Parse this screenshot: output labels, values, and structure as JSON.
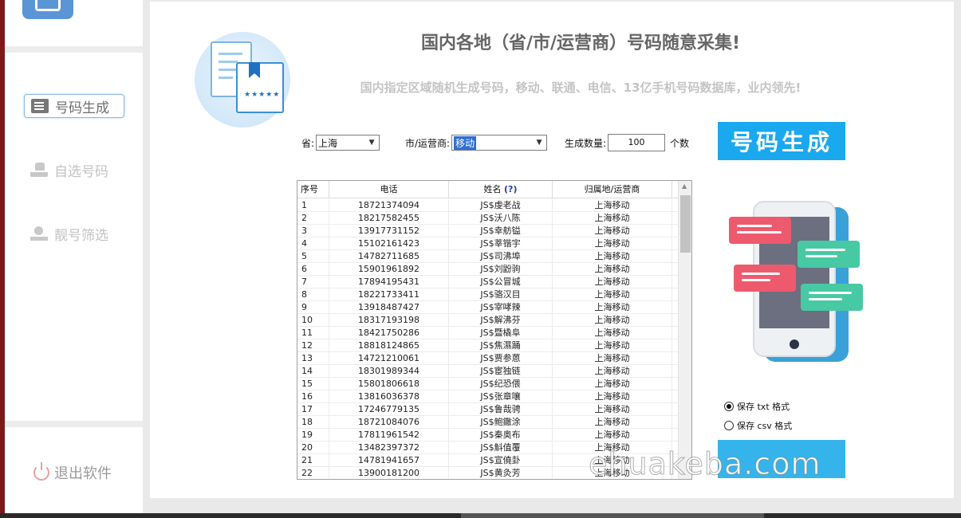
{
  "sidebar": {
    "items": [
      {
        "label": "号码生成",
        "icon": "list-icon",
        "active": true
      },
      {
        "label": "自选号码",
        "icon": "hand-icon",
        "active": false
      },
      {
        "label": "靓号筛选",
        "icon": "gem-icon",
        "active": false
      }
    ],
    "exit_label": "退出软件"
  },
  "header": {
    "title": "国内各地（省/市/运营商）号码随意采集!",
    "subtitle": "国内指定区域随机生成号码，移动、联通、电信、13亿手机号码数据库，业内领先!"
  },
  "form": {
    "province_label": "省:",
    "province_value": "上海",
    "city_label": "市/运营商:",
    "city_value": "移动",
    "count_label": "生成数量:",
    "count_value": "100",
    "count_unit": "个数",
    "generate_button": "号码生成"
  },
  "table": {
    "columns": [
      "序号",
      "电话",
      "姓名",
      "(?)",
      "归属地/运营商"
    ],
    "rows": [
      [
        "1",
        "18721374094",
        "JS$虔老战",
        "上海移动"
      ],
      [
        "2",
        "18217582455",
        "JS$沃八陈",
        "上海移动"
      ],
      [
        "3",
        "13917731152",
        "JS$幸舫镒",
        "上海移动"
      ],
      [
        "4",
        "15102161423",
        "JS$莘锴宇",
        "上海移动"
      ],
      [
        "5",
        "14782711685",
        "JS$司沸埠",
        "上海移动"
      ],
      [
        "6",
        "15901961892",
        "JS$刘鼢驹",
        "上海移动"
      ],
      [
        "7",
        "17894195431",
        "JS$公冒城",
        "上海移动"
      ],
      [
        "8",
        "18221733411",
        "JS$骆汉目",
        "上海移动"
      ],
      [
        "9",
        "13918487427",
        "JS$宰哮辣",
        "上海移动"
      ],
      [
        "10",
        "18317193198",
        "JS$解沸芬",
        "上海移动"
      ],
      [
        "11",
        "18421750286",
        "JS$暨橇阜",
        "上海移动"
      ],
      [
        "12",
        "18818124865",
        "JS$焦濕踊",
        "上海移动"
      ],
      [
        "13",
        "14721210061",
        "JS$贾参蒽",
        "上海移动"
      ],
      [
        "14",
        "18301989344",
        "JS$宦独链",
        "上海移动"
      ],
      [
        "15",
        "15801806618",
        "JS$纪恐偎",
        "上海移动"
      ],
      [
        "16",
        "13816036378",
        "JS$张章嚷",
        "上海移动"
      ],
      [
        "17",
        "17246779135",
        "JS$鲁哉骋",
        "上海移动"
      ],
      [
        "18",
        "18721084076",
        "JS$鲍鏾涂",
        "上海移动"
      ],
      [
        "19",
        "17811961542",
        "JS$秦奥布",
        "上海移动"
      ],
      [
        "20",
        "13482397372",
        "JS$斛值覆",
        "上海移动"
      ],
      [
        "21",
        "14781941657",
        "JS$宣僥卦",
        "上海移动"
      ],
      [
        "22",
        "13900181200",
        "JS$黄灸芳",
        "上海移动"
      ]
    ]
  },
  "options": {
    "save_txt": "保存 txt 格式",
    "save_csv": "保存 csv 格式",
    "selected": "txt"
  },
  "watermark": "ehuakeba.com",
  "colors": {
    "accent": "#1aa8ee",
    "window_frame": "#7a1a1a"
  }
}
